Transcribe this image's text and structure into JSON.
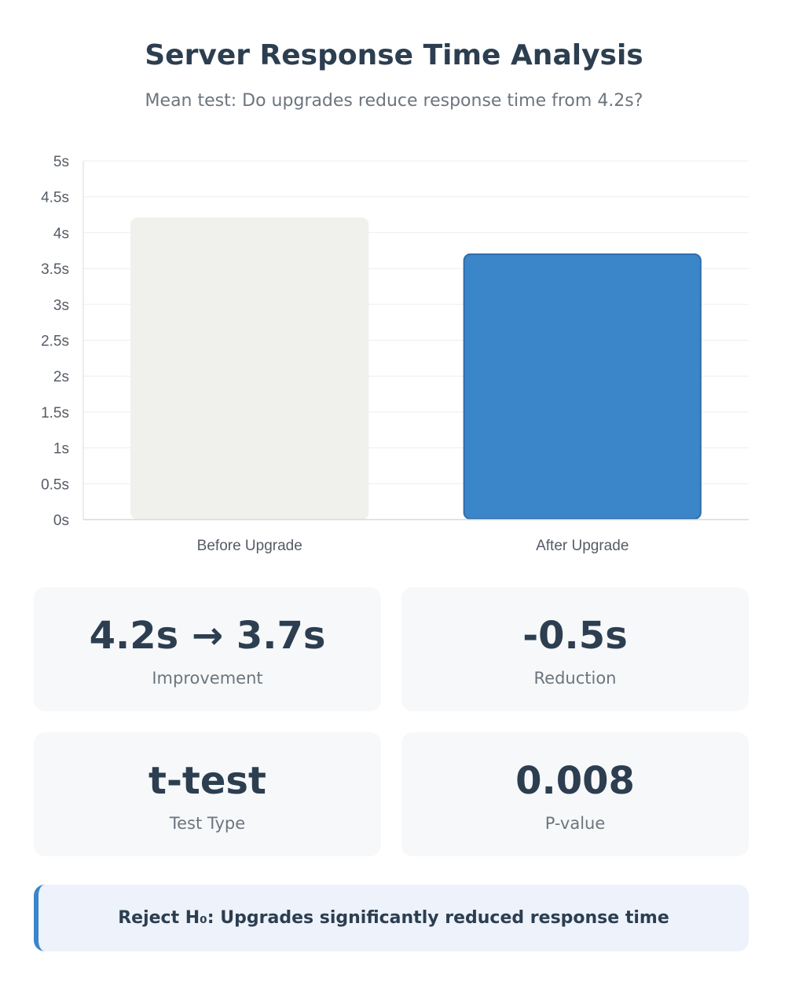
{
  "header": {
    "title": "Server Response Time Analysis",
    "subtitle": "Mean test: Do upgrades reduce response time from 4.2s?"
  },
  "chart_data": {
    "type": "bar",
    "categories": [
      "Before Upgrade",
      "After Upgrade"
    ],
    "values": [
      4.2,
      3.7
    ],
    "ylim": [
      0,
      5
    ],
    "yticks": [
      0,
      0.5,
      1,
      1.5,
      2,
      2.5,
      3,
      3.5,
      4,
      4.5,
      5
    ],
    "ytick_labels": [
      "0s",
      "0.5s",
      "1s",
      "1.5s",
      "2s",
      "2.5s",
      "3s",
      "3.5s",
      "4s",
      "4.5s",
      "5s"
    ],
    "bar_colors": [
      "#f0f0ec",
      "#3a86c8"
    ],
    "bar_border_colors": [
      "#f0f0ec",
      "#2f6eac"
    ],
    "grid": true,
    "legend": false
  },
  "stats": {
    "improvement": {
      "value": "4.2s → 3.7s",
      "label": "Improvement"
    },
    "reduction": {
      "value": "-0.5s",
      "label": "Reduction"
    },
    "test_type": {
      "value": "t-test",
      "label": "Test Type"
    },
    "p_value": {
      "value": "0.008",
      "label": "P-value"
    }
  },
  "conclusion": {
    "text": "Reject H₀: Upgrades significantly reduced response time"
  },
  "colors": {
    "accent": "#3a86c8",
    "title": "#2c3e50",
    "muted": "#6c757d",
    "card_bg": "#f7f8fa",
    "conclusion_bg": "#edf2fb"
  }
}
